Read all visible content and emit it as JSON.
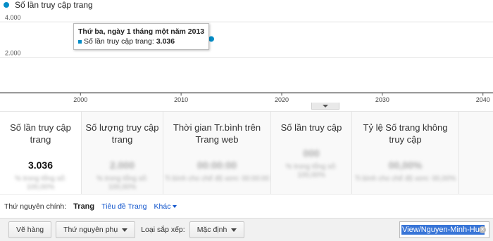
{
  "colors": {
    "series": "#058dc7",
    "link": "#1155cc",
    "selection": "#3875d7"
  },
  "chart_data": {
    "type": "scatter",
    "series": [
      {
        "name": "Số lần truy cập trang",
        "x": [
          2013.0
        ],
        "y": [
          3036
        ]
      }
    ],
    "x_ticks": [
      "2000",
      "2010",
      "2020",
      "2030",
      "2040"
    ],
    "x_range": [
      1992,
      2041
    ],
    "y_ticks": [
      "4.000",
      "2.000"
    ],
    "y_range": [
      0,
      4600
    ],
    "grid": true,
    "tooltip": {
      "title": "Thứ ba, ngày 1 tháng một năm 2013",
      "label": "Số lần truy cập trang:",
      "value": "3.036"
    }
  },
  "metrics": [
    {
      "title": "Số lần truy cập trang",
      "value": "3.036",
      "sub": "% trong tổng số: 100,00%",
      "active": true
    },
    {
      "title": "Số lượng truy cập trang",
      "value": "2.000",
      "sub": "% trong tổng số: 100,00%",
      "active": false
    },
    {
      "title": "Thời gian Tr.bình trên Trang web",
      "value": "00:00:00",
      "sub": "Tr.bình cho chế độ xem: 00:00:00",
      "active": false
    },
    {
      "title": "Số lần truy cập",
      "value": "000",
      "sub": "% trong tổng số: 100,00%",
      "active": false
    },
    {
      "title": "Tỷ lệ Số trang không truy cập",
      "value": "00,00%",
      "sub": "Tr.bình cho chế độ xem: 00,00%",
      "active": false
    },
    {
      "title": "",
      "value": "",
      "sub": "",
      "active": false
    }
  ],
  "dimension": {
    "label": "Thứ nguyên chính:",
    "active": "Trang",
    "link": "Tiêu đề Trang",
    "more": "Khác"
  },
  "toolbar": {
    "plot_rows": "Vẽ hàng",
    "secondary_dimension": "Thứ nguyên phụ",
    "sort_label": "Loại sắp xếp:",
    "sort_value": "Mặc định",
    "search_value": "View/Nguyen-Minh-Hue"
  }
}
